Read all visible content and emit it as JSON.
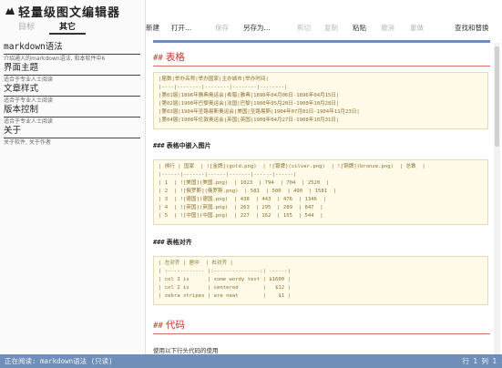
{
  "app": {
    "title": "轻量级图文编辑器"
  },
  "sidebar": {
    "tabs": [
      {
        "label": "目标"
      },
      {
        "label": "其它"
      }
    ],
    "items": [
      {
        "title": "markdown语法",
        "desc": "介绍通入的markdown语法, 和本软件中6"
      },
      {
        "title": "界面主题",
        "desc": "适合于专业人士阅读"
      },
      {
        "title": "文章样式",
        "desc": "适合于专业人士阅读"
      },
      {
        "title": "版本控制",
        "desc": "适合于专业人士阅读"
      },
      {
        "title": "关于",
        "desc": "关于软件, 关于作者"
      }
    ]
  },
  "toolbar": {
    "new": "新建",
    "open": "打开...",
    "save": "保存",
    "save_as": "另存为...",
    "cut": "剪切",
    "copy": "复制",
    "paste": "粘贴",
    "undo": "撤消",
    "redo": "重做",
    "find_replace": "查找和替换"
  },
  "editor": {
    "h_table": {
      "marker": "##",
      "text": "表格"
    },
    "table1": [
      "|届数|举办名称|举办国家|主办城市|举办时间|",
      "|----|--------|--------|--------|--------|",
      "|第01届|1896年雅典奥运会|希腊|雅典|1896年04月06日-1896年04月15日|",
      "|第02届|1900年巴黎奥运会|法国|巴黎|1900年05月20日-1900年10月28日|",
      "|第03届|1904年圣路易斯奥运会|美国|圣路易斯|1904年07月01日-1904年11月23日|",
      "|第04届|1908年伦敦奥运会|英国|英国|1908年04月27日-1908年10月31日|"
    ],
    "h_img": {
      "marker": "###",
      "text": "表格中嵌入图片"
    },
    "table2": [
      "| 排行 | 国家  | ![金牌](gold.png)  | ![银牌](silver.png)  | ![铜牌](bronze.png)  | 总数  |",
      "|------|-------|------|-------|------|------|",
      "| 1  | ![美国](美国.png)  | 1023  | 794  | 704  | 2520  |",
      "| 2  | ![俄罗斯](俄罗斯.png)  | 581  | 500  | 490  | 1581  |",
      "| 3  | ![德国](德国.png)  | 438  | 443  | 476  | 1346  |",
      "| 4  | ![英国](英国.png)  | 263  | 295  | 289  | 847  |",
      "| 5  | ![中国](中国.png)  | 227  | 162  | 155  | 544  |"
    ],
    "h_align": {
      "marker": "###",
      "text": "表格对齐"
    },
    "table3": [
      "| 左对齐 | 居中  | 右对齐 |",
      "| :------------ |:---------------:| -----:|",
      "| col 3 is      | some wordy text | $1600 |",
      "| col 2 is      | centered        |   $12 |",
      "| zebra stripes | are neat        |    $1 |"
    ],
    "h_code": {
      "marker": "##",
      "text": "代码"
    },
    "code_intro": "使用以下行头代码的使用"
  },
  "status": {
    "left": "正在阅读: markdown语法 (只读)",
    "right": "行 1 列 1"
  },
  "colors": {
    "heading": "#c0392b",
    "accent": "#6a8fc0",
    "statusbar": "#6f8fb8",
    "codebox_bg": "#fffbe8"
  }
}
